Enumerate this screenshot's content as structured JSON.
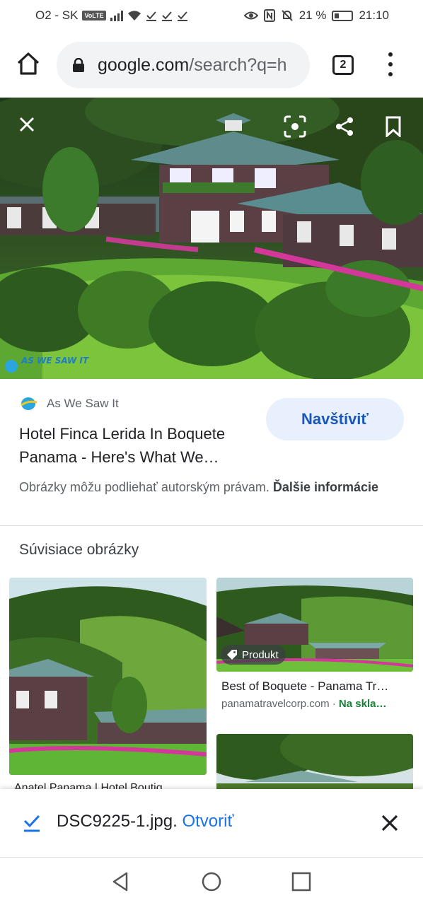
{
  "status_bar": {
    "carrier": "O2 - SK",
    "volte": "VoLTE",
    "battery_percent": "21 %",
    "time": "21:10",
    "icons": [
      "signal-icon",
      "wifi-icon",
      "check-icon",
      "check-icon",
      "check-icon",
      "eye-icon",
      "nfc-icon",
      "mute-icon",
      "battery-icon"
    ]
  },
  "browser": {
    "url_host": "google.com",
    "url_path": "/search?q=h",
    "tab_count": "2"
  },
  "image_viewer": {
    "watermark": "AS WE SAW IT",
    "source_name": "As We Saw It",
    "visit_label": "Navštíviť",
    "title_line1": "Hotel Finca Lerida In Boquete",
    "title_line2": "Panama - Here's What We…",
    "copyright_text": "Obrázky môžu podliehať autorským právam.",
    "more_info": "Ďalšie informácie"
  },
  "related": {
    "heading": "Súvisiace obrázky",
    "items": [
      {
        "caption": "Anatel Panama | Hotel Boutiq"
      },
      {
        "badge": "Produkt",
        "caption": "Best of Boquete - Panama Tr…",
        "domain": "panamatravelcorp.com",
        "stock": "Na skla…"
      },
      {
        "caption": ""
      }
    ]
  },
  "download": {
    "filename": "DSC9225-1.jpg.",
    "open_label": "Otvoriť"
  },
  "colors": {
    "accent": "#1a73e8",
    "visit_bg": "#e8f0fe",
    "stock_green": "#188038"
  }
}
